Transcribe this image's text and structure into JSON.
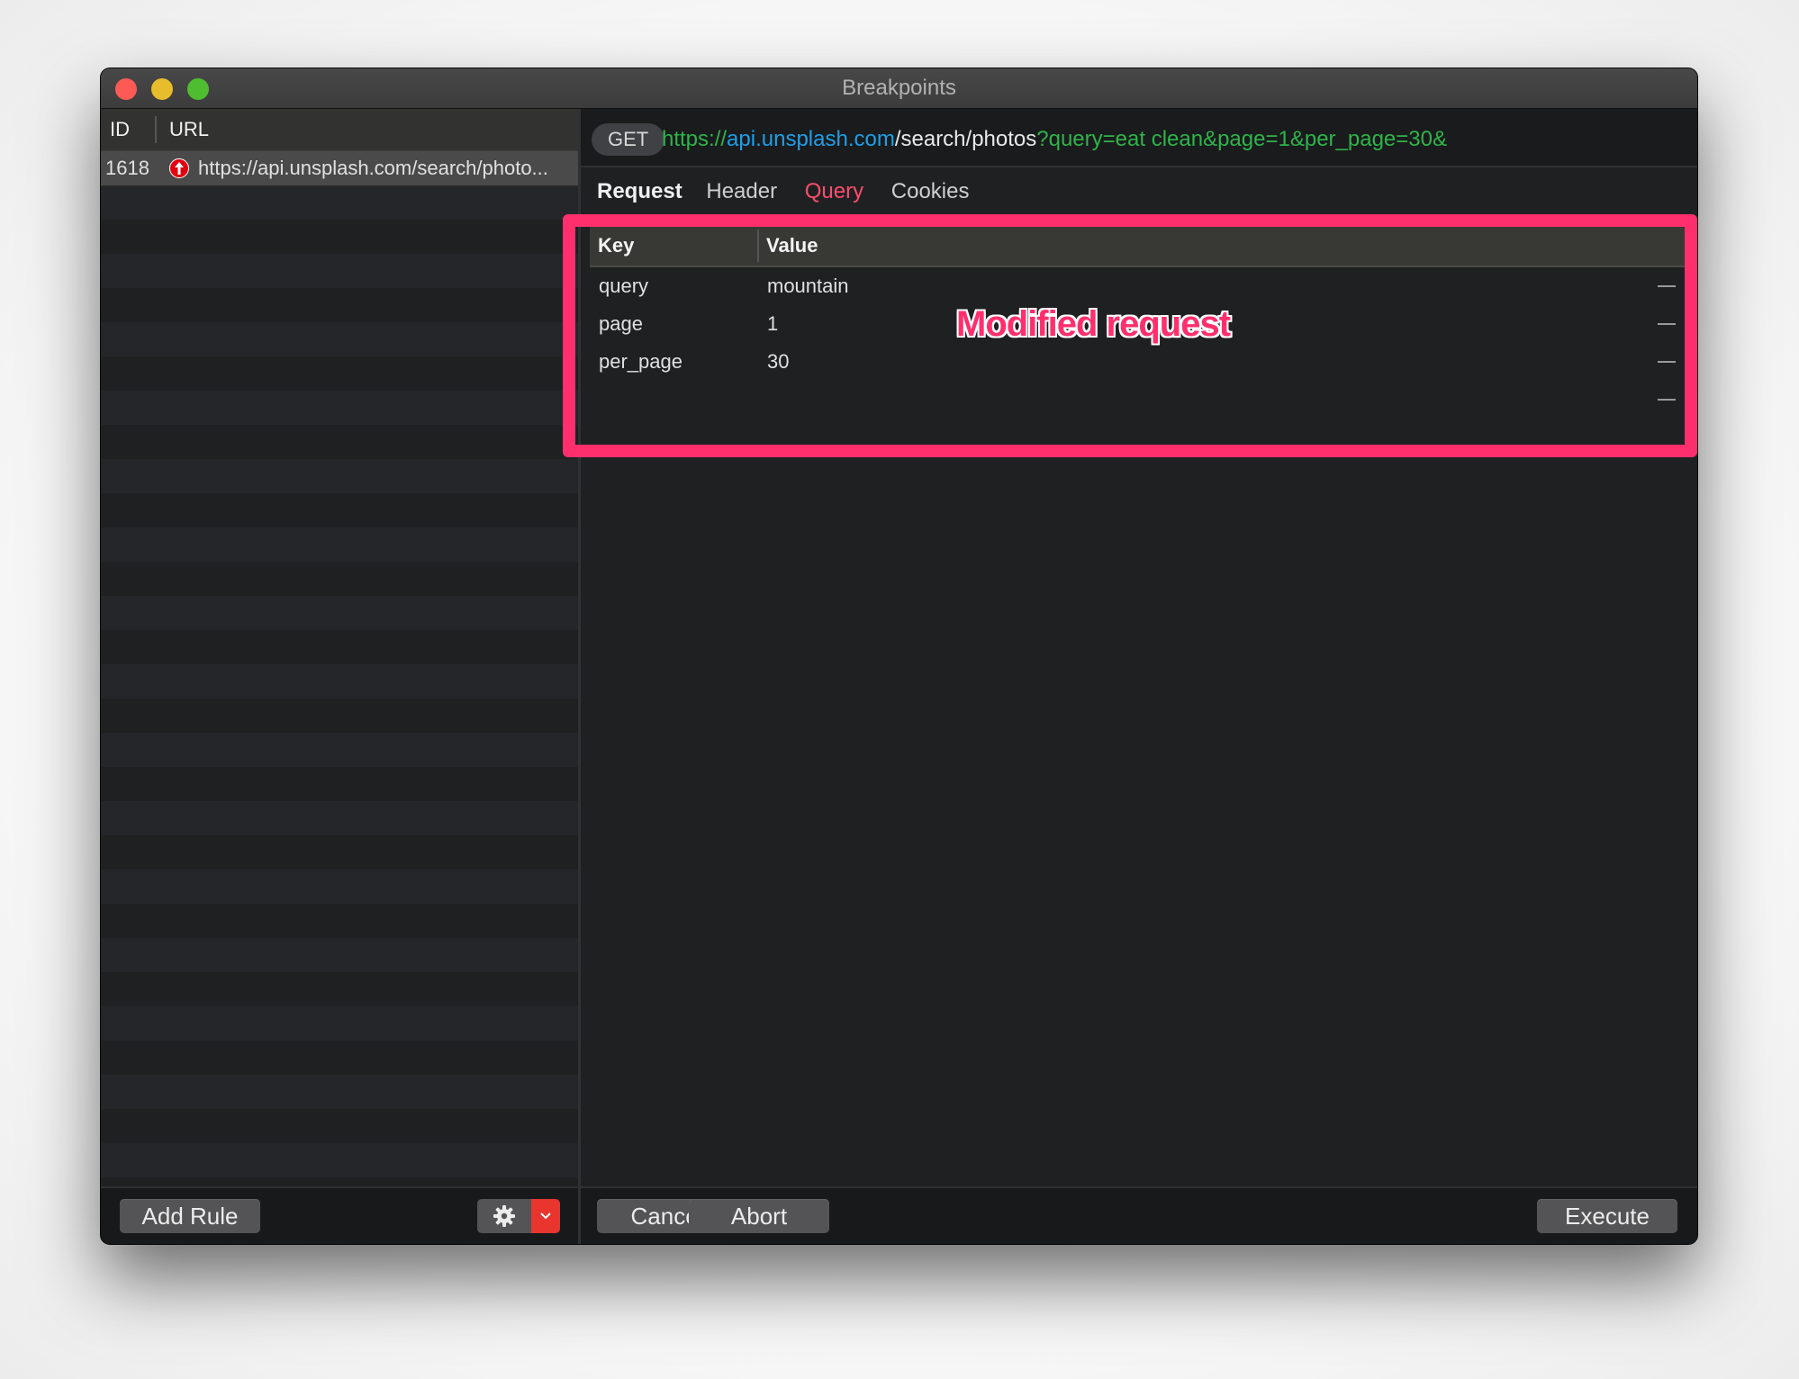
{
  "window": {
    "title": "Breakpoints"
  },
  "breakpoint_list": {
    "columns": {
      "id": "ID",
      "url": "URL"
    },
    "rows": [
      {
        "id": "1618",
        "icon": "request-upload-icon",
        "url": "https://api.unsplash.com/search/photo..."
      }
    ]
  },
  "request": {
    "method": "GET",
    "url": {
      "scheme": "https://",
      "host": "api.unsplash.com",
      "path": "/search/photos",
      "query": "?query=eat clean&page=1&per_page=30&"
    },
    "section_title": "Request",
    "tabs": [
      {
        "label": "Header",
        "active": false
      },
      {
        "label": "Query",
        "active": true
      },
      {
        "label": "Cookies",
        "active": false
      }
    ],
    "table": {
      "columns": {
        "key": "Key",
        "value": "Value"
      },
      "rows": [
        {
          "key": "query",
          "value": "mountain"
        },
        {
          "key": "page",
          "value": "1"
        },
        {
          "key": "per_page",
          "value": "30"
        },
        {
          "key": "",
          "value": ""
        }
      ]
    }
  },
  "annotation": {
    "text": "Modified request",
    "color": "#ff2f6d"
  },
  "footer": {
    "add_rule": "Add Rule",
    "cancel": "Cancel",
    "abort": "Abort",
    "execute": "Execute"
  },
  "colors": {
    "accent_tab": "#ff4d6d",
    "url_green": "#2fb44a",
    "url_blue": "#1e9fe8",
    "dropdown_red": "#e8352e"
  }
}
